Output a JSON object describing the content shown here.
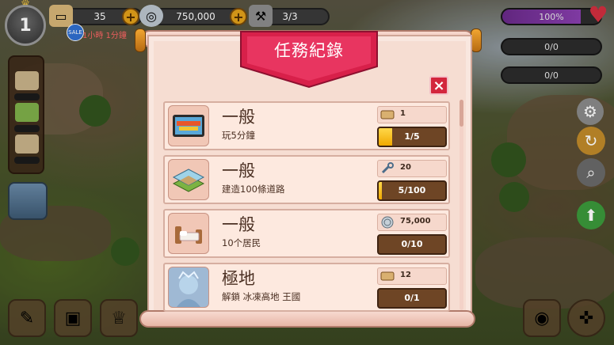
{
  "hud": {
    "level": "1",
    "resources": [
      {
        "icon": "wood-plank-icon",
        "value": "35"
      },
      {
        "icon": "silver-coin-icon",
        "value": "750,000"
      },
      {
        "icon": "hammer-icon",
        "value": "3/3"
      }
    ],
    "sale_badge": "SALE",
    "sale_timer": "1小時 1分鐘",
    "right_bars": [
      "100%",
      "0/0",
      "0/0"
    ]
  },
  "dialog": {
    "title": "任務紀錄",
    "close_label": "×"
  },
  "quests": [
    {
      "category": "一般",
      "description": "玩5分鐘",
      "icon": "fantasy-island-tablet-icon",
      "reward_icon": "wood-plank-icon",
      "reward": "1",
      "progress_text": "1/5",
      "progress": 0.2
    },
    {
      "category": "一般",
      "description": "建造100條道路",
      "icon": "road-tiles-icon",
      "reward_icon": "wrench-icon",
      "reward": "20",
      "progress_text": "5/100",
      "progress": 0.05
    },
    {
      "category": "一般",
      "description": "10个居民",
      "icon": "bed-icon",
      "reward_icon": "silver-coin-icon",
      "reward": "75,000",
      "progress_text": "0/10",
      "progress": 0.0
    },
    {
      "category": "極地",
      "description": "解鎖 冰凍高地 王國",
      "icon": "ice-queen-portrait-icon",
      "reward_icon": "wood-plank-icon",
      "reward": "12",
      "progress_text": "0/1",
      "progress": 0.0
    }
  ]
}
